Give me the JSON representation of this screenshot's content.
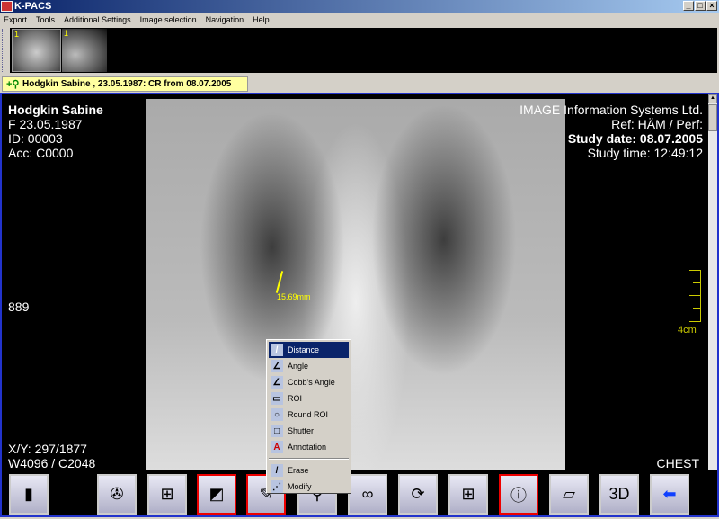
{
  "window": {
    "title": "K-PACS",
    "buttons": [
      "_",
      "□",
      "×"
    ]
  },
  "menu": [
    "Export",
    "Tools",
    "Additional Settings",
    "Image selection",
    "Navigation",
    "Help"
  ],
  "thumbnails": [
    {
      "label": "1"
    },
    {
      "label": "1"
    }
  ],
  "patient_tab": "Hodgkin  Sabine , 23.05.1987: CR from 08.07.2005",
  "overlay": {
    "name": "Hodgkin  Sabine",
    "sex_dob": "F  23.05.1987",
    "id": "ID: 00003",
    "acc": "Acc: C0000",
    "institution": "IMAGE Information Systems Ltd.",
    "ref": "Ref: HÄM  / Perf:",
    "study_date": "Study date: 08.07.2005",
    "study_time": "Study time: 12:49:12",
    "slice": "889",
    "xy": "X/Y: 297/1877",
    "wc": "W4096 / C2048",
    "body_part": "CHEST"
  },
  "measurement": "15.69mm",
  "ruler_label": "4cm",
  "context_menu": [
    {
      "label": "Distance",
      "icon": "ruler-icon",
      "glyph": "/"
    },
    {
      "label": "Angle",
      "icon": "angle-icon",
      "glyph": "∠"
    },
    {
      "label": "Cobb's Angle",
      "icon": "cobb-angle-icon",
      "glyph": "∠"
    },
    {
      "label": "ROI",
      "icon": "roi-icon",
      "glyph": "▭"
    },
    {
      "label": "Round ROI",
      "icon": "round-roi-icon",
      "glyph": "○"
    },
    {
      "label": "Shutter",
      "icon": "shutter-icon",
      "glyph": "□"
    },
    {
      "label": "Annotation",
      "icon": "annotation-icon",
      "glyph": "A"
    },
    {
      "label": "Erase",
      "icon": "erase-icon",
      "glyph": "/"
    },
    {
      "label": "Modify",
      "icon": "modify-icon",
      "glyph": "⋰"
    }
  ],
  "toolbar": [
    {
      "icon": "cabinet-icon",
      "glyph": "▮"
    },
    {
      "icon": "film-reel-icon",
      "glyph": "✇"
    },
    {
      "icon": "window-icon",
      "glyph": "⊞"
    },
    {
      "icon": "window-level-icon",
      "glyph": "◩"
    },
    {
      "icon": "measure-icon",
      "glyph": "✎"
    },
    {
      "icon": "magnifier-icon",
      "glyph": "⚲"
    },
    {
      "icon": "binoculars-icon",
      "glyph": "∞"
    },
    {
      "icon": "rotate-icon",
      "glyph": "⟳"
    },
    {
      "icon": "layout-grid-icon",
      "glyph": "⊞"
    },
    {
      "icon": "info-icon",
      "glyph": "ⓘ"
    },
    {
      "icon": "report-icon",
      "glyph": "▱"
    },
    {
      "icon": "3d-icon",
      "glyph": "3D"
    },
    {
      "icon": "back-arrow-icon",
      "glyph": "⬅"
    }
  ]
}
